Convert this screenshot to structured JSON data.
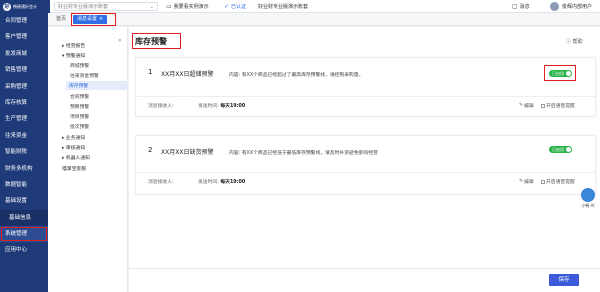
{
  "topbar": {
    "brand": "畅捷通好会计",
    "shop_placeholder": "好业财专业版演示账套",
    "demo_label": "我要看实例演示",
    "certified_label": "已认证",
    "account_label": "好业财专业版演示账套",
    "messages_label": "消息",
    "user_name": "俊辉内部用户"
  },
  "nav": {
    "items": [
      {
        "label": "合同管理"
      },
      {
        "label": "客户管理"
      },
      {
        "label": "批发商城"
      },
      {
        "label": "销售管理"
      },
      {
        "label": "采购管理"
      },
      {
        "label": "库存核算"
      },
      {
        "label": "生产管理"
      },
      {
        "label": "往来资金"
      },
      {
        "label": "智能财税"
      },
      {
        "label": "财务多机构"
      },
      {
        "label": "数据智能"
      },
      {
        "label": "基础设置"
      },
      {
        "label": "基础信息",
        "sub": true
      },
      {
        "label": "系统管理",
        "active": true
      },
      {
        "label": "应用中心"
      }
    ]
  },
  "tabs": {
    "home": "首页",
    "current": "消息设置",
    "close": "×"
  },
  "tree": {
    "collapse_icon": "«",
    "nodes": [
      {
        "label": "▸ 经营报告",
        "level": 0
      },
      {
        "label": "▾ 预警通知",
        "level": 0
      },
      {
        "label": "商城预警",
        "level": 1
      },
      {
        "label": "往来资金预警",
        "level": 1
      },
      {
        "label": "库存预警",
        "level": 1,
        "active": true
      },
      {
        "label": "合同预警",
        "level": 1
      },
      {
        "label": "预算预警",
        "level": 1
      },
      {
        "label": "项目预警",
        "level": 1
      },
      {
        "label": "批次预警",
        "level": 1
      },
      {
        "label": "▸ 业务通知",
        "level": 0
      },
      {
        "label": "▸ 审核通知",
        "level": 0
      },
      {
        "label": "▸ 机器人通知",
        "level": 0
      },
      {
        "label": "喵掌宝客服",
        "level": 0
      }
    ]
  },
  "main": {
    "title": "库存预警",
    "help_label": "帮助",
    "cards": [
      {
        "num": "1",
        "name": "XX月XX日超储预警",
        "content": "内容:  有XX个商品已经超过了最高库存预警线，请控制采购量。",
        "toggle": "已启用",
        "receiver_label": "消息接收人:",
        "time_label": "发送时间:",
        "time_value": "每天19:00",
        "edit_label": "编辑",
        "voice_label": "开启语音提醒"
      },
      {
        "num": "2",
        "name": "XX月XX日缺货预警",
        "content": "内容:  有XX个商品已经低于最低库存预警线，请及时补货避免影响经营",
        "toggle": "已启用",
        "receiver_label": "消息接收人:",
        "time_label": "发送时间:",
        "time_value": "每天19:00",
        "edit_label": "编辑",
        "voice_label": "开启语音提醒"
      }
    ],
    "save_label": "保存"
  },
  "helper": {
    "label": "小畅 AI"
  },
  "colors": {
    "nav_bg": "#1f3a78",
    "accent": "#2f6fe4",
    "toggle_on": "#27b34a",
    "highlight": "#e02020",
    "save": "#3b5bdb"
  }
}
